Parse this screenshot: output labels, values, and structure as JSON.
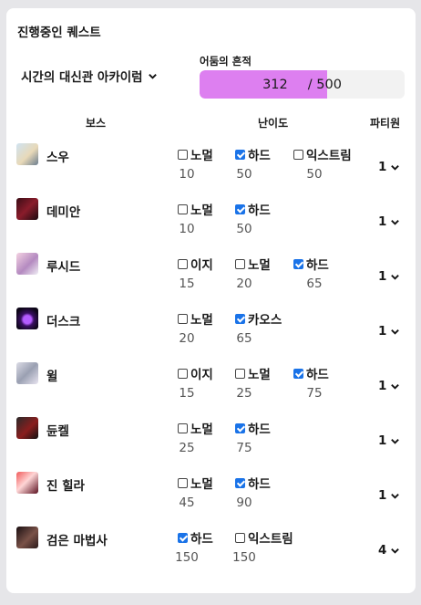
{
  "panel_title": "진행중인 퀘스트",
  "area": {
    "selected": "시간의 대신관 아카이럼"
  },
  "progress": {
    "label": "어둠의 흔적",
    "current": "312",
    "max_text": "/ 500",
    "fraction": 0.624,
    "fill_color": "#dd7ff0"
  },
  "headers": {
    "boss": "보스",
    "difficulty": "난이도",
    "party": "파티원"
  },
  "colors": {
    "accent": "#1a73e8",
    "progress_fill": "#dd7ff0"
  },
  "bosses": [
    {
      "name": "스우",
      "icon": "swoo-portrait-icon",
      "party": "1",
      "difficulties": [
        {
          "label": "노멀",
          "checked": false,
          "value": "10"
        },
        {
          "label": "하드",
          "checked": true,
          "value": "50"
        },
        {
          "label": "익스트림",
          "checked": false,
          "value": "50"
        }
      ]
    },
    {
      "name": "데미안",
      "icon": "damien-portrait-icon",
      "party": "1",
      "difficulties": [
        {
          "label": "노멀",
          "checked": false,
          "value": "10"
        },
        {
          "label": "하드",
          "checked": true,
          "value": "50"
        }
      ]
    },
    {
      "name": "루시드",
      "icon": "lucid-portrait-icon",
      "party": "1",
      "difficulties": [
        {
          "label": "이지",
          "checked": false,
          "value": "15"
        },
        {
          "label": "노멀",
          "checked": false,
          "value": "20"
        },
        {
          "label": "하드",
          "checked": true,
          "value": "65"
        }
      ]
    },
    {
      "name": "더스크",
      "icon": "dusk-portrait-icon",
      "party": "1",
      "difficulties": [
        {
          "label": "노멀",
          "checked": false,
          "value": "20"
        },
        {
          "label": "카오스",
          "checked": true,
          "value": "65"
        }
      ]
    },
    {
      "name": "윌",
      "icon": "will-portrait-icon",
      "party": "1",
      "difficulties": [
        {
          "label": "이지",
          "checked": false,
          "value": "15"
        },
        {
          "label": "노멀",
          "checked": false,
          "value": "25"
        },
        {
          "label": "하드",
          "checked": true,
          "value": "75"
        }
      ]
    },
    {
      "name": "듄켈",
      "icon": "dunkel-portrait-icon",
      "party": "1",
      "difficulties": [
        {
          "label": "노멀",
          "checked": false,
          "value": "25"
        },
        {
          "label": "하드",
          "checked": true,
          "value": "75"
        }
      ]
    },
    {
      "name": "진 힐라",
      "icon": "jin-hilla-portrait-icon",
      "party": "1",
      "difficulties": [
        {
          "label": "노멀",
          "checked": false,
          "value": "45"
        },
        {
          "label": "하드",
          "checked": true,
          "value": "90"
        }
      ]
    },
    {
      "name": "검은 마법사",
      "icon": "black-mage-portrait-icon",
      "party": "4",
      "difficulties": [
        {
          "label": "하드",
          "checked": true,
          "value": "150"
        },
        {
          "label": "익스트림",
          "checked": false,
          "value": "150"
        }
      ]
    }
  ]
}
